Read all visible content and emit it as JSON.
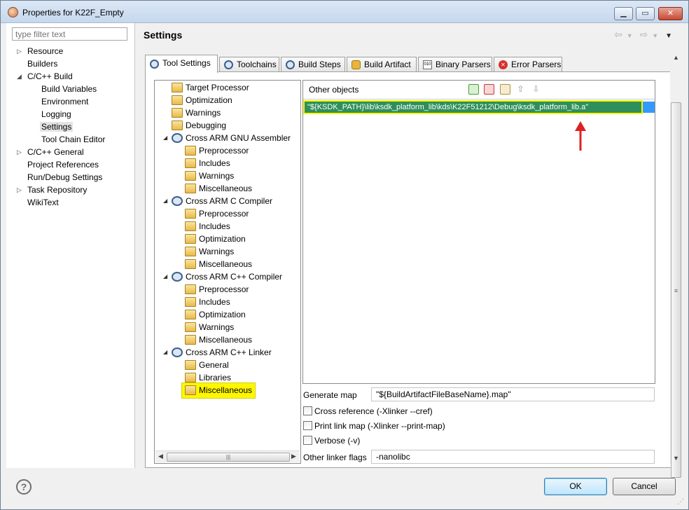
{
  "window": {
    "title": "Properties for K22F_Empty"
  },
  "left": {
    "filter_placeholder": "type filter text",
    "items": [
      {
        "label": "Resource",
        "expandable": true
      },
      {
        "label": "Builders"
      },
      {
        "label": "C/C++ Build",
        "expanded": true
      },
      {
        "label": "Build Variables"
      },
      {
        "label": "Environment"
      },
      {
        "label": "Logging"
      },
      {
        "label": "Settings",
        "selected": true
      },
      {
        "label": "Tool Chain Editor"
      },
      {
        "label": "C/C++ General",
        "expandable": true
      },
      {
        "label": "Project References"
      },
      {
        "label": "Run/Debug Settings"
      },
      {
        "label": "Task Repository",
        "expandable": true
      },
      {
        "label": "WikiText"
      }
    ]
  },
  "header": {
    "title": "Settings"
  },
  "tabs": [
    {
      "label": "Tool Settings",
      "active": true
    },
    {
      "label": "Toolchains"
    },
    {
      "label": "Build Steps"
    },
    {
      "label": "Build Artifact"
    },
    {
      "label": "Binary Parsers"
    },
    {
      "label": "Error Parsers"
    }
  ],
  "tree": [
    {
      "label": "Target Processor"
    },
    {
      "label": "Optimization"
    },
    {
      "label": "Warnings"
    },
    {
      "label": "Debugging"
    },
    {
      "label": "Cross ARM GNU Assembler"
    },
    {
      "label": "Preprocessor"
    },
    {
      "label": "Includes"
    },
    {
      "label": "Warnings"
    },
    {
      "label": "Miscellaneous"
    },
    {
      "label": "Cross ARM C Compiler"
    },
    {
      "label": "Preprocessor"
    },
    {
      "label": "Includes"
    },
    {
      "label": "Optimization"
    },
    {
      "label": "Warnings"
    },
    {
      "label": "Miscellaneous"
    },
    {
      "label": "Cross ARM C++ Compiler"
    },
    {
      "label": "Preprocessor"
    },
    {
      "label": "Includes"
    },
    {
      "label": "Optimization"
    },
    {
      "label": "Warnings"
    },
    {
      "label": "Miscellaneous"
    },
    {
      "label": "Cross ARM C++ Linker"
    },
    {
      "label": "General"
    },
    {
      "label": "Libraries"
    },
    {
      "label": "Miscellaneous",
      "highlighted": true
    }
  ],
  "objects": {
    "title": "Other objects",
    "value": "\"${KSDK_PATH}\\lib\\ksdk_platform_lib\\kds\\K22F51212\\Debug\\ksdk_platform_lib.a\""
  },
  "form": {
    "generate_map_label": "Generate map",
    "generate_map_value": "\"${BuildArtifactFileBaseName}.map\"",
    "cross_reference_label": "Cross reference (-Xlinker --cref)",
    "print_link_map_label": "Print link map (-Xlinker --print-map)",
    "verbose_label": "Verbose (-v)",
    "other_flags_label": "Other linker flags",
    "other_flags_value": "-nanolibc"
  },
  "buttons": {
    "ok": "OK",
    "cancel": "Cancel"
  },
  "colors": {
    "highlight": "#fff700",
    "selection": "#2f8f5a",
    "arrow": "#e02020"
  }
}
